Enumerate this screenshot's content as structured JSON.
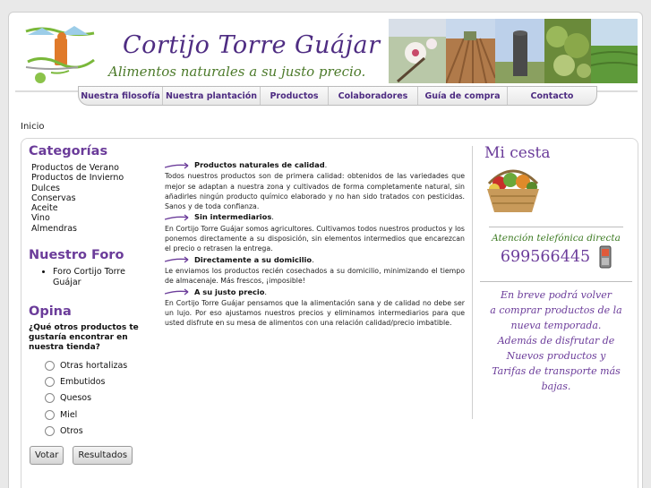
{
  "header": {
    "title": "Cortijo Torre Guájar",
    "slogan": "Alimentos naturales a su justo precio."
  },
  "nav": [
    {
      "label": "Nuestra filosofía"
    },
    {
      "label": "Nuestra plantación"
    },
    {
      "label": "Productos"
    },
    {
      "label": "Colaboradores"
    },
    {
      "label": "Guía de compra"
    },
    {
      "label": "Contacto"
    }
  ],
  "breadcrumb": "Inicio",
  "categorias": {
    "title": "Categorías",
    "items": [
      "Productos de Verano",
      "Productos de Invierno",
      "Dulces",
      "Conservas",
      "Aceite",
      "Vino",
      "Almendras"
    ]
  },
  "foro": {
    "title": "Nuestro Foro",
    "items": [
      "Foro Cortijo Torre Guájar"
    ]
  },
  "opina": {
    "title": "Opina",
    "question": "¿Qué otros productos te gustaría encontrar en nuestra tienda?",
    "options": [
      "Otras hortalizas",
      "Embutidos",
      "Quesos",
      "Miel",
      "Otros"
    ],
    "vote_label": "Votar",
    "results_label": "Resultados"
  },
  "main": {
    "sections": [
      {
        "heading": "Productos naturales de calidad",
        "suffix": ".",
        "text": "Todos nuestros productos son de primera calidad: obtenidos de las variedades que mejor se adaptan a nuestra zona y cultivados de forma completamente natural, sin añadirles ningún producto químico elaborado y no han sido tratados con pesticidas. Sanos y de toda confianza."
      },
      {
        "heading": "Sin intermediarios",
        "suffix": ".",
        "text": "En Cortijo Torre Guájar somos agricultores. Cultivamos todos nuestros productos y los ponemos directamente a su disposición, sin elementos intermedios que encarezcan el precio o retrasen la entrega."
      },
      {
        "heading": "Directamente a su domicilio",
        "suffix": ".",
        "text": "Le enviamos los productos recién cosechados a su domicilio, minimizando el tiempo de almacenaje. Más frescos, ¡imposible!"
      },
      {
        "heading": "A su justo precio",
        "suffix": ".",
        "text": "En Cortijo Torre Guájar pensamos que la alimentación sana y de calidad no debe ser un lujo. Por eso ajustamos nuestros precios y eliminamos intermediarios para que usted disfrute en su mesa de alimentos con una relación calidad/precio imbatible."
      }
    ]
  },
  "sidebar_right": {
    "cart_title": "Mi cesta",
    "phone_label": "Atención telefónica directa",
    "phone": "699566445",
    "promo_lines": [
      "En breve podrá volver",
      "a comprar productos de la",
      "nueva temporada.",
      "Además de disfrutar de",
      "Nuevos productos y",
      "Tarifas de transporte más bajas."
    ]
  },
  "colors": {
    "accent_purple": "#6b3c9a",
    "title_purple": "#4e2c82",
    "accent_green": "#3c7a22"
  }
}
